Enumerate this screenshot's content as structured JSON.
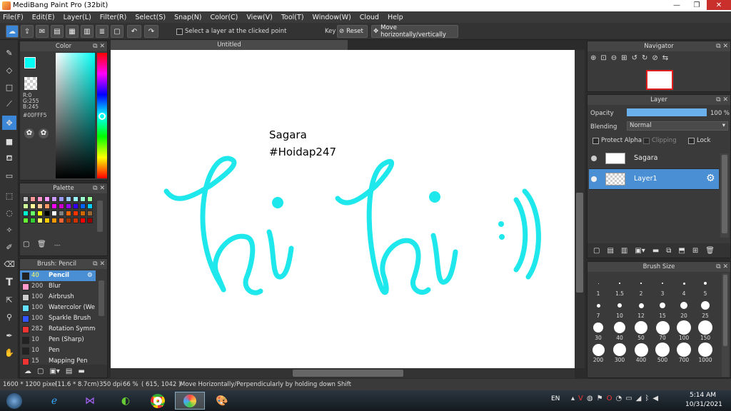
{
  "window": {
    "title": "MediBang Paint Pro (32bit)",
    "min_label": "—",
    "max_label": "❐",
    "close_label": "✕"
  },
  "menu": [
    "File(F)",
    "Edit(E)",
    "Layer(L)",
    "Filter(R)",
    "Select(S)",
    "Snap(N)",
    "Color(C)",
    "View(V)",
    "Tool(T)",
    "Window(W)",
    "Cloud",
    "Help"
  ],
  "toolbar": {
    "select_layer_label": "Select a layer at the clicked point",
    "key_label": "Key",
    "reset_label": "Reset",
    "move_label": "Move horizontally/vertically"
  },
  "color_panel": {
    "title": "Color",
    "r": "R:0",
    "g": "G:255",
    "b": "B:245",
    "hex": "#00FFF5",
    "primary": "#00FFF5"
  },
  "palette_panel": {
    "title": "Palette",
    "more": "---",
    "colors": [
      "#c0c0c0",
      "#ff9999",
      "#ff99cc",
      "#ff99ff",
      "#cc99ff",
      "#9999ff",
      "#99ccff",
      "#99ffff",
      "#99ffcc",
      "#99ff99",
      "#ccff99",
      "#ffff99",
      "#ffcc99",
      "#ff9966",
      "#ff00ff",
      "#cc00cc",
      "#9900ff",
      "#3300ff",
      "#0066ff",
      "#00ccff",
      "#00ffcc",
      "#66ff66",
      "#ffff00",
      "#000000",
      "#ffffff",
      "#808080",
      "#ff6600",
      "#ff3300",
      "#cc6600",
      "#996633",
      "#66ff33",
      "#33cc33",
      "#ffff66",
      "#ffcc00",
      "#ff9900",
      "#ff6633",
      "#993300",
      "#cc3300",
      "#ff0000",
      "#990000"
    ]
  },
  "brush_panel": {
    "title": "Brush: Pencil",
    "items": [
      {
        "size": "40",
        "name": "Pencil",
        "color": "#222",
        "active": true
      },
      {
        "size": "200",
        "name": "Blur",
        "color": "#ff99cc"
      },
      {
        "size": "100",
        "name": "Airbrush",
        "color": "#cccccc"
      },
      {
        "size": "100",
        "name": "Watercolor (We",
        "color": "#66e0ff"
      },
      {
        "size": "100",
        "name": "Sparkle Brush",
        "color": "#3355ff"
      },
      {
        "size": "282",
        "name": "Rotation Symme",
        "color": "#ee3333"
      },
      {
        "size": "10",
        "name": "Pen (Sharp)",
        "color": "#222"
      },
      {
        "size": "10",
        "name": "Pen",
        "color": "#222"
      },
      {
        "size": "15",
        "name": "Mapping Pen",
        "color": "#ee3333"
      }
    ]
  },
  "canvas": {
    "tab": "Untitled",
    "text_line1": "Sagara",
    "text_line2": "#Hoidap247",
    "stroke_color": "#1ee8ec"
  },
  "navigator": {
    "title": "Navigator"
  },
  "layer_panel": {
    "title": "Layer",
    "opacity_label": "Opacity",
    "opacity_value": "100 %",
    "opacity_fraction": 1.0,
    "blending_label": "Blending",
    "blending_value": "Normal",
    "protect_alpha": "Protect Alpha",
    "clipping": "Clipping",
    "lock": "Lock",
    "layers": [
      {
        "name": "Sagara",
        "thumb": "text"
      },
      {
        "name": "Layer1",
        "thumb": "checker",
        "active": true
      }
    ]
  },
  "brush_size_panel": {
    "title": "Brush Size",
    "sizes": [
      "1",
      "1.5",
      "2",
      "3",
      "4",
      "5",
      "7",
      "10",
      "12",
      "15",
      "20",
      "25",
      "30",
      "40",
      "50",
      "70",
      "100",
      "150",
      "200",
      "300",
      "400",
      "500",
      "700",
      "1000"
    ]
  },
  "status": {
    "size": "1600 * 1200 pixel",
    "inches": "(11.6 * 8.7cm)",
    "dpi": "350 dpi",
    "zoom": "66 %",
    "coords": "( 615, 1042 )",
    "hint": "Move Horizontally/Perpendicularly by holding down Shift"
  },
  "taskbar": {
    "lang": "EN",
    "time": "5:14 AM",
    "date": "10/31/2021"
  }
}
